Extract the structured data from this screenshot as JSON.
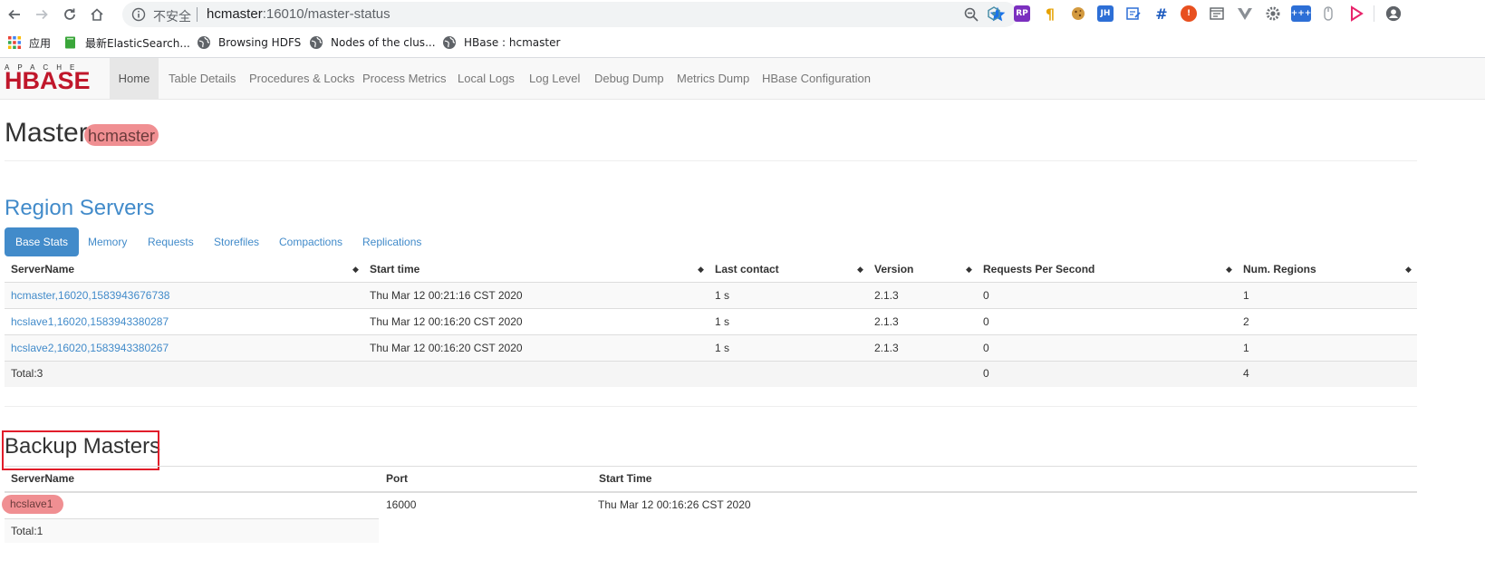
{
  "browser": {
    "insecure_label": "不安全",
    "url_host": "hcmaster",
    "url_path": ":16010/master-status",
    "bookmarks": [
      {
        "label": "应用"
      },
      {
        "label": "最新ElasticSearch..."
      },
      {
        "label": "Browsing HDFS"
      },
      {
        "label": "Nodes of the clus..."
      },
      {
        "label": "HBase : hcmaster"
      }
    ],
    "ext_labels": {
      "rp": "RP",
      "jh": "JH"
    }
  },
  "hbase": {
    "logo_top": "APACHE",
    "logo_word": "HBASE",
    "tabs": [
      {
        "label": "Home"
      },
      {
        "label": "Table Details"
      },
      {
        "label": "Procedures & Locks"
      },
      {
        "label": "Process Metrics"
      },
      {
        "label": "Local Logs"
      },
      {
        "label": "Log Level"
      },
      {
        "label": "Debug Dump"
      },
      {
        "label": "Metrics Dump"
      },
      {
        "label": "HBase Configuration"
      }
    ]
  },
  "master": {
    "title": "Master",
    "host": "hcmaster"
  },
  "region_servers": {
    "title": "Region Servers",
    "pills": [
      {
        "label": "Base Stats"
      },
      {
        "label": "Memory"
      },
      {
        "label": "Requests"
      },
      {
        "label": "Storefiles"
      },
      {
        "label": "Compactions"
      },
      {
        "label": "Replications"
      }
    ],
    "columns": [
      "ServerName",
      "Start time",
      "Last contact",
      "Version",
      "Requests Per Second",
      "Num. Regions"
    ],
    "rows": [
      [
        "hcmaster,16020,1583943676738",
        "Thu Mar 12 00:21:16 CST 2020",
        "1 s",
        "2.1.3",
        "0",
        "1"
      ],
      [
        "hcslave1,16020,1583943380287",
        "Thu Mar 12 00:16:20 CST 2020",
        "1 s",
        "2.1.3",
        "0",
        "2"
      ],
      [
        "hcslave2,16020,1583943380267",
        "Thu Mar 12 00:16:20 CST 2020",
        "1 s",
        "2.1.3",
        "0",
        "1"
      ]
    ],
    "total": {
      "label": "Total:3",
      "requests": "0",
      "regions": "4"
    }
  },
  "backup_masters": {
    "title": "Backup Masters",
    "columns": [
      "ServerName",
      "Port",
      "Start Time"
    ],
    "rows": [
      [
        "hcslave1",
        "16000",
        "Thu Mar 12 00:16:26 CST 2020"
      ]
    ],
    "total": "Total:1"
  },
  "colors": {
    "link": "#428bca",
    "highlight": "#f08f92",
    "annotation_box": "#e11d2a",
    "logo_red": "#c0172b"
  }
}
